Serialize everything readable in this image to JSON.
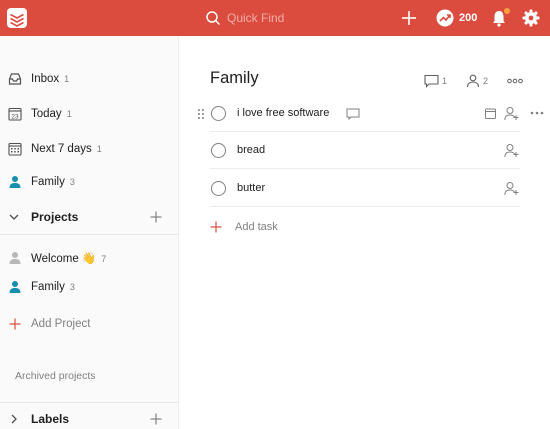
{
  "topbar": {
    "search_placeholder": "Quick Find",
    "karma_score": "200",
    "accent_color": "#db4c3f",
    "notification_dot_color": "#f9a03f"
  },
  "sidebar": {
    "filters": [
      {
        "label": "Inbox",
        "count": "1",
        "icon": "inbox-icon"
      },
      {
        "label": "Today",
        "count": "1",
        "icon": "calendar-today-icon"
      },
      {
        "label": "Next 7 days",
        "count": "1",
        "icon": "calendar-week-icon"
      },
      {
        "label": "Family",
        "count": "3",
        "icon": "person-icon"
      }
    ],
    "projects_title": "Projects",
    "projects": [
      {
        "label": "Welcome 👋",
        "count": "7",
        "icon": "person-icon",
        "color": "#b8b8b8"
      },
      {
        "label": "Family",
        "count": "3",
        "icon": "person-icon",
        "color": "#158fad"
      }
    ],
    "add_project_label": "Add Project",
    "archived_label": "Archived projects",
    "labels_title": "Labels"
  },
  "main": {
    "project_title": "Family",
    "comments_count": "1",
    "collaborators_count": "2",
    "tasks": [
      {
        "text": "i love free software",
        "has_comment": true,
        "has_due": true
      },
      {
        "text": "bread",
        "has_comment": false,
        "has_due": false
      },
      {
        "text": "butter",
        "has_comment": false,
        "has_due": false
      }
    ],
    "add_task_label": "Add task"
  }
}
